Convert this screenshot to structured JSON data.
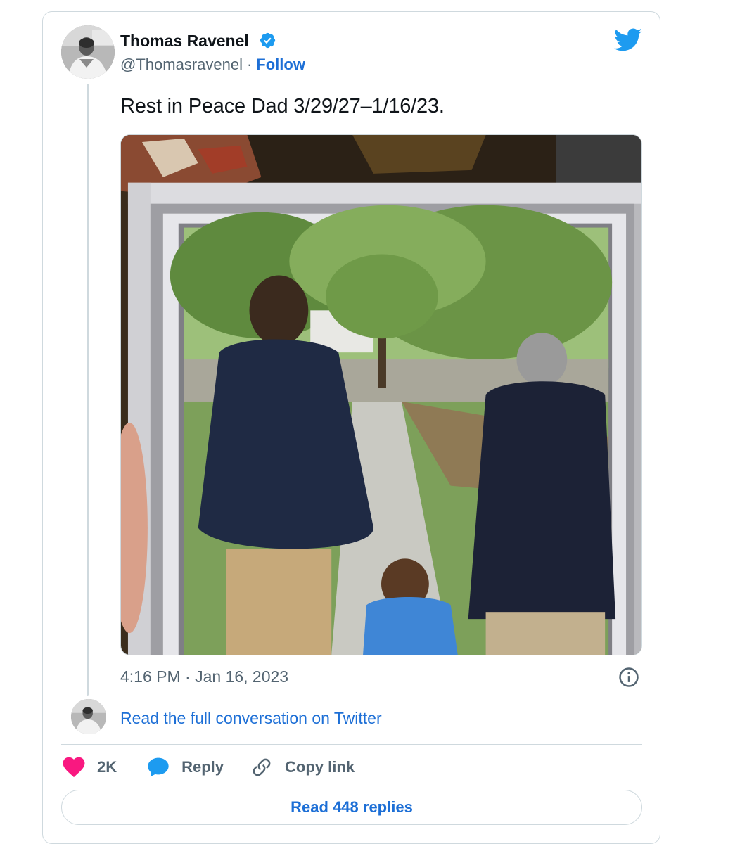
{
  "author": {
    "name": "Thomas Ravenel",
    "handle": "@Thomasravenel",
    "separator": "·",
    "follow_label": "Follow"
  },
  "icons": {
    "verified": "verified-badge-icon",
    "brand": "twitter-bird-icon",
    "info": "info-icon",
    "like": "heart-icon",
    "reply": "speech-bubble-icon",
    "copy": "link-icon"
  },
  "tweet": {
    "text": "Rest in Peace Dad 3/29/27–1/16/23.",
    "timestamp": "4:16 PM · Jan 16, 2023"
  },
  "conversation": {
    "read_full_label": "Read the full conversation on Twitter"
  },
  "actions": {
    "like_count": "2K",
    "reply_label": "Reply",
    "copy_label": "Copy link"
  },
  "footer": {
    "read_replies_label": "Read 448 replies"
  },
  "colors": {
    "link": "#1d6fd6",
    "twitter_blue": "#1d9bf0",
    "like_pink": "#f91880",
    "muted_text": "#536471",
    "border": "#cfd9de"
  }
}
